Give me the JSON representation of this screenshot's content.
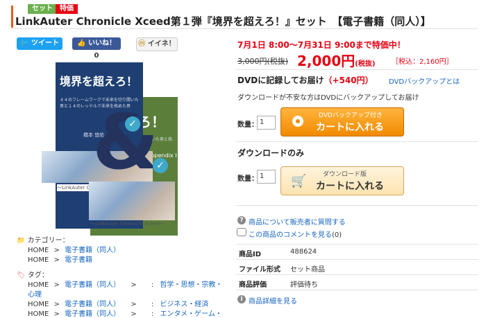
{
  "badges": {
    "set": "セット",
    "sale": "特価"
  },
  "title": "LinkAuter Chronicle Xceed第１弾『境界を超えろ！』セット　【電子書籍（同人）】",
  "share": {
    "tweet": "ツイート",
    "like": "いいね！",
    "like_count": "0",
    "mixi": "イイネ！"
  },
  "cover": {
    "title_main": "境界を超えろ！",
    "title_side": "えろ！",
    "subtitle_main": "４４のフレームワークで未来を切り開いた男と１４のレッテルで未来を拓めた男",
    "subtitle_side": "来を切り開いた男と拓めた男",
    "author": "橋本 悠佑",
    "appendix": "Appendix Ⅰ",
    "caption_main": "〜LinkAuter Chronicle Xceed〜",
    "caption_side": "〜LinkAuter Chronicle Xceed〜"
  },
  "category": {
    "label": "カテゴリー：",
    "rows": [
      {
        "home": "HOME",
        "sep": ">",
        "link": "電子書籍（同人）"
      },
      {
        "home": "HOME",
        "sep": ">",
        "link": "電子書籍"
      }
    ]
  },
  "tags": {
    "label": "タグ：",
    "rows": [
      {
        "home": "HOME",
        "sep": ">",
        "link": "電子書籍（同人）",
        "sep2": ">",
        "sep3": ":",
        "tag": "哲学・思想・宗教・"
      },
      {
        "home": "",
        "sep": "",
        "link": "",
        "sep2": "",
        "sep3": "",
        "tag": "心理"
      },
      {
        "home": "HOME",
        "sep": ">",
        "link": "電子書籍（同人）",
        "sep2": ">",
        "sep3": ":",
        "tag": "ビジネス・経済"
      },
      {
        "home": "HOME",
        "sep": ">",
        "link": "電子書籍（同人）",
        "sep2": ">",
        "sep3": ":",
        "tag": "エンタメ・ゲーム・"
      }
    ]
  },
  "price": {
    "sale_period": "7月1日 8:00〜7月31日 9:00まで特価中！",
    "old": "3,000円(税抜)",
    "new": "2,000円",
    "new_suffix": "(税抜)",
    "tax_in": "［税込：2,160円］"
  },
  "dvd": {
    "heading": "DVDに記録してお届け",
    "plus": "（+540円）",
    "link": "DVDバックアップとは",
    "note": "ダウンロードが不安な方はDVDにバックアップしてお届け",
    "qty_label": "数量：",
    "qty": "1",
    "btn_small": "DVDバックアップ付き",
    "btn_big": "カートに入れる"
  },
  "download": {
    "heading": "ダウンロードのみ",
    "qty_label": "数量：",
    "qty": "1",
    "btn_small": "ダウンロード版",
    "btn_big": "カートに入れる"
  },
  "links": {
    "ask": "商品について販売者に質問する",
    "comments": "この商品のコメントを見る",
    "comments_count": "(0)",
    "details": "商品詳細を見る"
  },
  "info": [
    {
      "label": "商品ID",
      "value": "488624"
    },
    {
      "label": "ファイル形式",
      "value": "セット商品"
    },
    {
      "label": "商品評価",
      "value": "評価待ち"
    }
  ],
  "colors": {
    "accent": "#e85a1a",
    "price_red": "#e60012",
    "link": "#1565c0",
    "cart_orange": "#f08a00"
  }
}
